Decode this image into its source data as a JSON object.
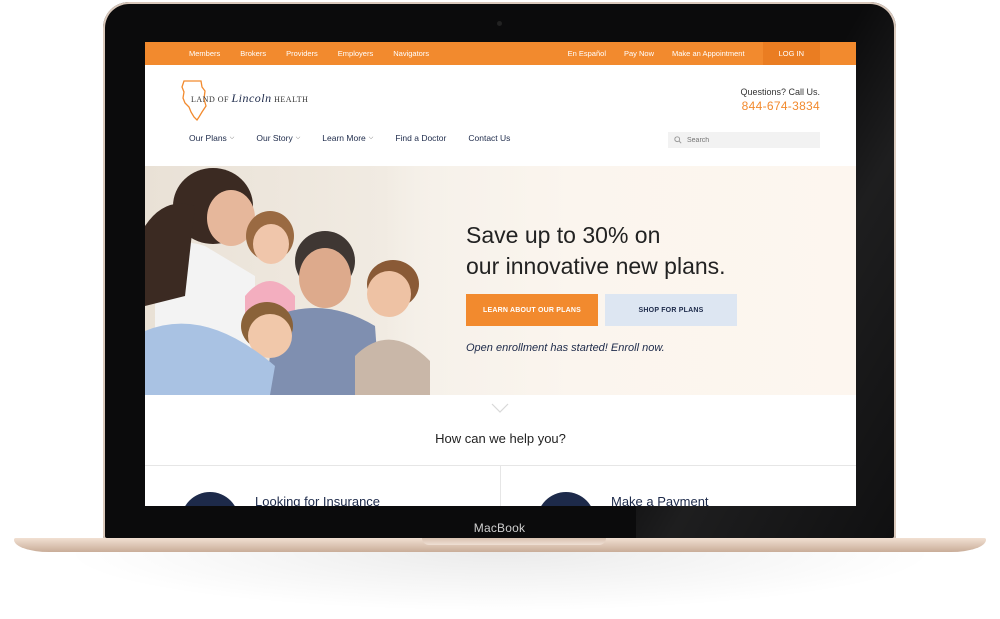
{
  "device": {
    "label": "MacBook"
  },
  "topbar": {
    "left": [
      "Members",
      "Brokers",
      "Providers",
      "Employers",
      "Navigators"
    ],
    "right": [
      "En Español",
      "Pay Now",
      "Make an Appointment"
    ],
    "login": "LOG IN"
  },
  "logo": {
    "prefix": "LAND OF",
    "script": "Lincoln",
    "suffix": "HEALTH"
  },
  "contact": {
    "question": "Questions? Call Us.",
    "phone": "844-674-3834"
  },
  "nav": {
    "items": [
      "Our Plans",
      "Our Story",
      "Learn More",
      "Find a Doctor",
      "Contact Us"
    ],
    "search_placeholder": "Search"
  },
  "hero": {
    "headline_1": "Save up to 30% on",
    "headline_2": "our innovative new plans.",
    "primary_button": "LEARN ABOUT OUR PLANS",
    "secondary_button": "SHOP FOR PLANS",
    "tagline": "Open enrollment has started! Enroll now."
  },
  "help": {
    "heading": "How can we help you?",
    "cards": [
      "Looking for Insurance",
      "Make a Payment"
    ]
  },
  "colors": {
    "orange": "#f28a2e",
    "navy": "#1d2a4a",
    "light_blue": "#dde6f2"
  }
}
